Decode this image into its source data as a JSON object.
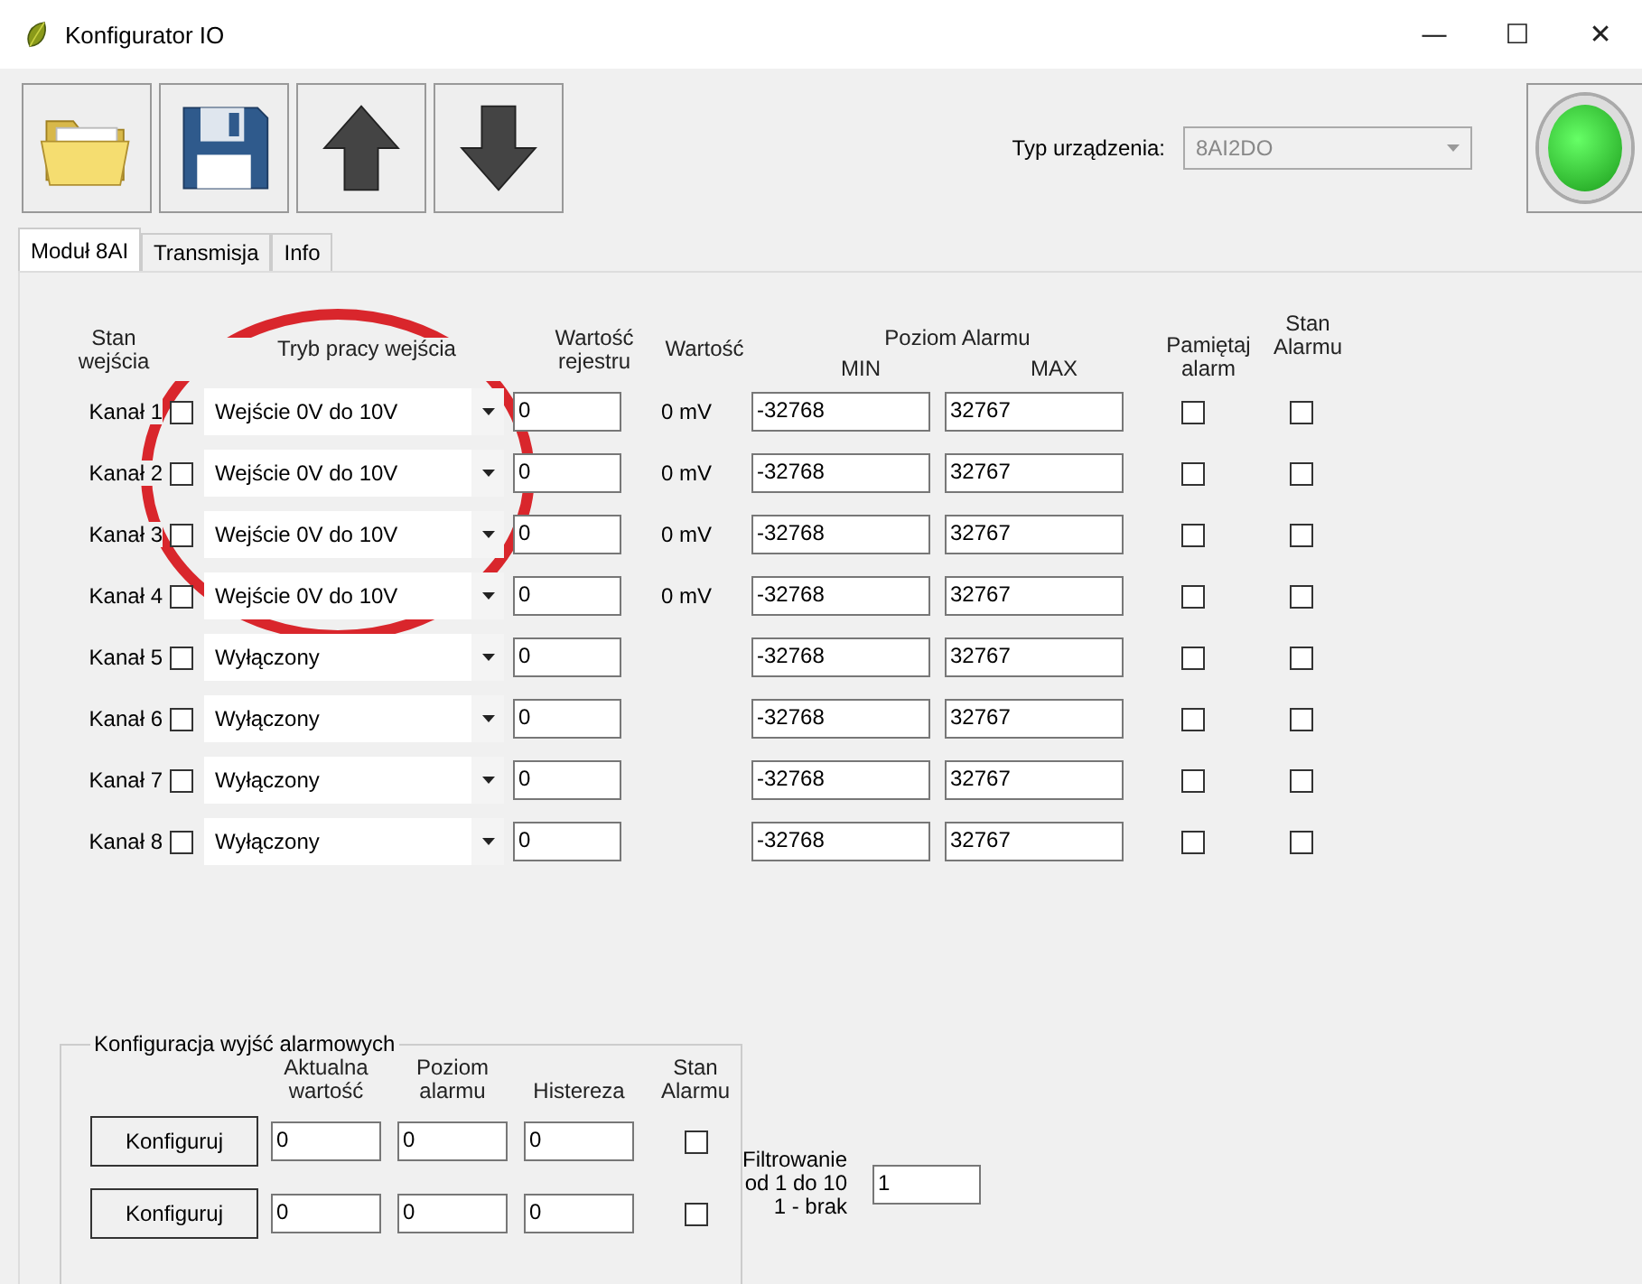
{
  "window": {
    "title": "Konfigurator IO",
    "controls": [
      "—",
      "☐",
      "✕"
    ]
  },
  "toolbar": {
    "device_label": "Typ urządzenia:",
    "device_value": "8AI2DO",
    "device_disabled": true,
    "led_on": true
  },
  "tabs": [
    {
      "label": "Moduł 8AI",
      "selected": true
    },
    {
      "label": "Transmisja",
      "selected": false
    },
    {
      "label": "Info",
      "selected": false
    }
  ],
  "headers": {
    "state": "Stan wejścia",
    "mode": "Tryb pracy wejścia",
    "register": "Wartość rejestru",
    "value": "Wartość",
    "alarm_level": "Poziom Alarmu",
    "min": "MIN",
    "max": "MAX",
    "remember": "Pamiętaj alarm",
    "alarm_state": "Stan Alarmu"
  },
  "channels": [
    {
      "label": "Kanał 1",
      "checked": false,
      "mode": "Wejście 0V do 10V",
      "register": "0",
      "value": "0 mV",
      "min": "-32768",
      "max": "32767",
      "remember": false,
      "alarm": false
    },
    {
      "label": "Kanał 2",
      "checked": false,
      "mode": "Wejście 0V do 10V",
      "register": "0",
      "value": "0 mV",
      "min": "-32768",
      "max": "32767",
      "remember": false,
      "alarm": false
    },
    {
      "label": "Kanał 3",
      "checked": false,
      "mode": "Wejście 0V do 10V",
      "register": "0",
      "value": "0 mV",
      "min": "-32768",
      "max": "32767",
      "remember": false,
      "alarm": false
    },
    {
      "label": "Kanał 4",
      "checked": false,
      "mode": "Wejście 0V do 10V",
      "register": "0",
      "value": "0 mV",
      "min": "-32768",
      "max": "32767",
      "remember": false,
      "alarm": false
    },
    {
      "label": "Kanał 5",
      "checked": false,
      "mode": "Wyłączony",
      "register": "0",
      "min": "-32768",
      "max": "32767",
      "remember": false,
      "alarm": false
    },
    {
      "label": "Kanał 6",
      "checked": false,
      "mode": "Wyłączony",
      "register": "0",
      "min": "-32768",
      "max": "32767",
      "remember": false,
      "alarm": false
    },
    {
      "label": "Kanał 7",
      "checked": false,
      "mode": "Wyłączony",
      "register": "0",
      "min": "-32768",
      "max": "32767",
      "remember": false,
      "alarm": false
    },
    {
      "label": "Kanał 8",
      "checked": false,
      "mode": "Wyłączony",
      "register": "0",
      "min": "-32768",
      "max": "32767",
      "remember": false,
      "alarm": false
    }
  ],
  "alarm_outputs": {
    "title": "Konfiguracja wyjść alarmowych",
    "headers": {
      "current": "Aktualna wartość",
      "level": "Poziom alarmu",
      "hysteresis": "Histereza",
      "state": "Stan Alarmu"
    },
    "rows": [
      {
        "button": "Konfiguruj",
        "current": "0",
        "level": "0",
        "hysteresis": "0",
        "alarm": false
      },
      {
        "button": "Konfiguruj",
        "current": "0",
        "level": "0",
        "hysteresis": "0",
        "alarm": false
      }
    ]
  },
  "filter": {
    "label_lines": [
      "Filtrowanie",
      "od 1 do 10",
      "1 - brak"
    ],
    "value": "1"
  }
}
